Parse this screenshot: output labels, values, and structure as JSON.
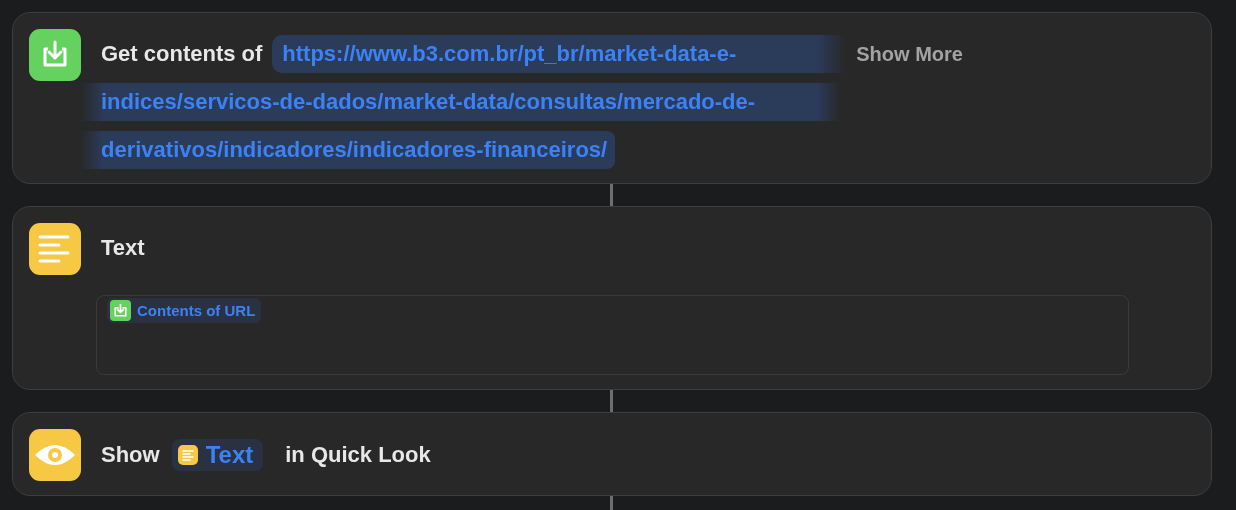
{
  "actions": [
    {
      "kind": "get_contents",
      "label": "Get contents of",
      "url_lines": [
        "https://www.b3.com.br/pt_br/market-data-e-",
        "indices/servicos-de-dados/market-data/consultas/mercado-de-",
        "derivativos/indicadores/indicadores-financeiros/"
      ],
      "show_more": "Show More"
    },
    {
      "kind": "text",
      "label": "Text",
      "field_token": "Contents of URL"
    },
    {
      "kind": "quick_look",
      "label": "Show",
      "token": "Text",
      "suffix": "in Quick Look"
    }
  ]
}
